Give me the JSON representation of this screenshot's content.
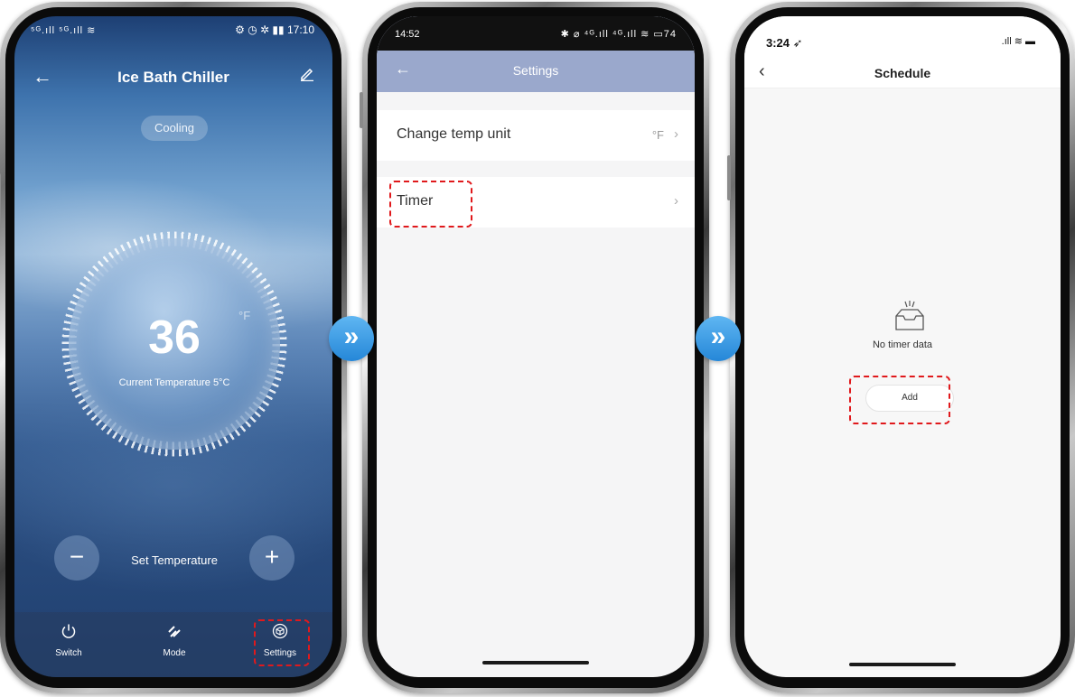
{
  "phone1": {
    "status": {
      "left": "⁵ᴳ.ıll ⁵ᴳ.ıll ≋",
      "right": "⚙ ◷ ✲ ▮▮ 17:10"
    },
    "header": {
      "title": "Ice Bath Chiller"
    },
    "mode_chip": "Cooling",
    "temperature": {
      "value": "36",
      "unit": "°F",
      "current": "Current Temperature 5°C"
    },
    "controls": {
      "minus": "−",
      "plus": "+",
      "set_label": "Set Temperature"
    },
    "tabs": [
      {
        "icon": "power-icon",
        "label": "Switch"
      },
      {
        "icon": "mode-icon",
        "label": "Mode"
      },
      {
        "icon": "settings-cube-icon",
        "label": "Settings"
      }
    ]
  },
  "phone2": {
    "status": {
      "time": "14:52",
      "icons": "✱ ⌀ ⁴ᴳ.ıll ⁴ᴳ.ıll ≋ ▭74"
    },
    "header": {
      "title": "Settings"
    },
    "rows": [
      {
        "label": "Change temp unit",
        "value": "°F"
      },
      {
        "label": "Timer",
        "value": ""
      }
    ]
  },
  "phone3": {
    "status": {
      "time": "3:24 ➶",
      "sys": ".ıll ≋ ▬"
    },
    "header": {
      "title": "Schedule"
    },
    "empty_text": "No timer data",
    "add_label": "Add"
  },
  "colors": {
    "highlight": "#e0191c",
    "arrow": "#2587d8",
    "settings_header": "#9aa8cc"
  }
}
